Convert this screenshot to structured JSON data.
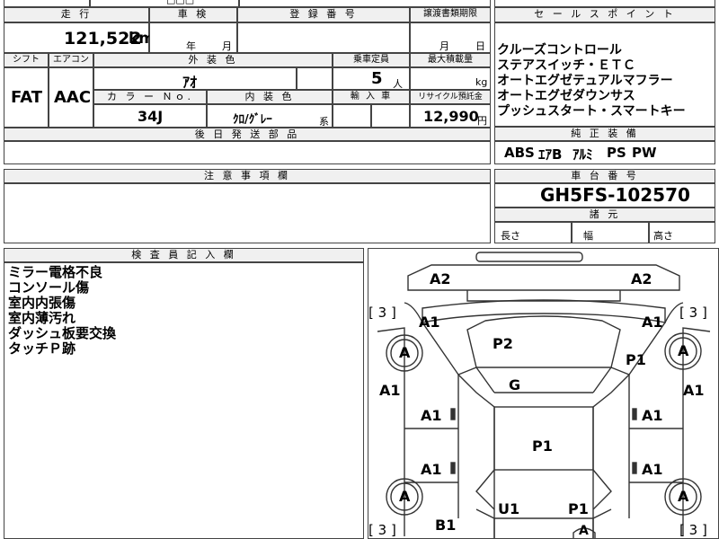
{
  "top_strip": {
    "partial_text": "□□□"
  },
  "mileage": {
    "label": "走 行",
    "value": "121,522",
    "unit": "km"
  },
  "inspection": {
    "label": "車 検",
    "year_unit": "年",
    "month_unit": "月"
  },
  "registration": {
    "label": "登 録 番 号"
  },
  "transfer": {
    "label": "譲渡書類期限",
    "month_unit": "月",
    "day_unit": "日"
  },
  "sales_points": {
    "label": "セ ー ル ス ポ イ ン ト",
    "items": [
      "クルーズコントロール",
      "ステアスイッチ・ＥＴＣ",
      "オートエグゼテュアルマフラー",
      "オートエグゼダウンサス",
      "プッシュスタート・スマートキー"
    ]
  },
  "shift": {
    "label": "シフト",
    "value": "FAT"
  },
  "aircon": {
    "label": "エアコン",
    "value": "AAC"
  },
  "exterior_color": {
    "label": "外 装 色",
    "value": "ｱｵ"
  },
  "capacity": {
    "label": "乗車定員",
    "value": "5",
    "unit": "人"
  },
  "max_load": {
    "label": "最大積載量",
    "unit": "kg"
  },
  "color_no": {
    "label": "カ ラ ー Ｎｏ.",
    "value": "34J"
  },
  "interior_color": {
    "label": "内 装 色",
    "value": "ｸﾛ/ｸﾞﾚｰ",
    "suffix": "系"
  },
  "import": {
    "label": "輸 入 車"
  },
  "recycle": {
    "label": "リサイクル預託金",
    "value": "12,990",
    "unit": "円"
  },
  "parts_later": {
    "label": "後 日 発 送 部 品"
  },
  "equipment": {
    "label": "純 正 装 備",
    "items": [
      "ABS",
      "ｴｱB",
      "ｱﾙﾐ",
      "PS",
      "PW"
    ]
  },
  "notes": {
    "label": "注 意 事 項 欄"
  },
  "chassis": {
    "label": "車 台 番 号",
    "value": "GH5FS-102570"
  },
  "dimensions": {
    "label": "諸 元",
    "length": "長さ",
    "width": "幅",
    "height": "高さ"
  },
  "inspector": {
    "label": "検 査 員 記 入 欄",
    "lines": [
      "ミラー電格不良",
      "コンソール傷",
      "室内内張傷",
      "室内薄汚れ",
      "ダッシュ板要交換",
      "タッチＰ跡"
    ]
  },
  "damage_map": {
    "codes": {
      "top_left": "A2",
      "top_right": "A2",
      "front_left_fender": "A1",
      "front_right_fender": "A1",
      "hood": "P2",
      "right_front_edge": "P1",
      "windshield": "G",
      "left_side": "A1",
      "right_side": "A1",
      "front_left_door": "A1",
      "front_right_door": "A1",
      "roof": "P1",
      "rear_left_door": "A1",
      "rear_right_door": "A1",
      "rear_left_quarter": "B1",
      "trunk_left": "U1",
      "trunk_right": "P1",
      "tire_fl": "A",
      "tire_fr": "A",
      "tire_rl": "A",
      "tire_rr": "A",
      "tire_spare": "A"
    },
    "bracket_values": {
      "front_left": "3",
      "front_right": "3",
      "rear_left": "3",
      "rear_right": "3"
    }
  }
}
